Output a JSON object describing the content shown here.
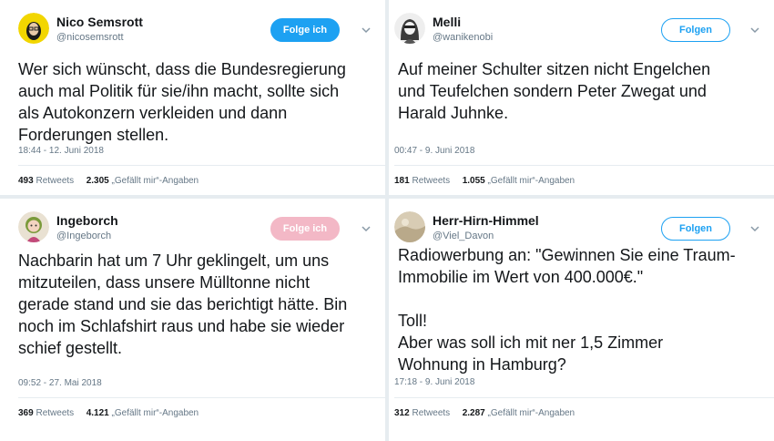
{
  "tweets": [
    {
      "name": "Nico Semsrott",
      "handle": "@nicosemsrott",
      "follow_label": "Folge ich",
      "text": "Wer sich wünscht, dass die Bundesregierung\nauch mal Politik für sie/ihn macht, sollte sich\nals Autokonzern verkleiden und dann\nForderungen stellen.",
      "time": "18:44 - 12. Juni 2018",
      "retweets": "493",
      "retweets_label": "Retweets",
      "likes": "2.305",
      "likes_label": "„Gefällt mir“-Angaben"
    },
    {
      "name": "Melli",
      "handle": "@wanikenobi",
      "follow_label": "Folgen",
      "text": "Auf meiner Schulter sitzen nicht Engelchen\nund Teufelchen sondern Peter Zwegat und\nHarald Juhnke.",
      "time": "00:47 - 9. Juni 2018",
      "retweets": "181",
      "retweets_label": "Retweets",
      "likes": "1.055",
      "likes_label": "„Gefällt mir“-Angaben"
    },
    {
      "name": "Ingeborch",
      "handle": "@Ingeborch",
      "follow_label": "Folge ich",
      "text": "Nachbarin hat um 7 Uhr geklingelt, um uns\nmitzuteilen, dass unsere Mülltonne nicht\ngerade stand und sie das berichtigt hätte. Bin\nnoch im Schlafshirt raus und habe sie wieder\nschief gestellt.",
      "time": "09:52 - 27. Mai 2018",
      "retweets": "369",
      "retweets_label": "Retweets",
      "likes": "4.121",
      "likes_label": "„Gefällt mir“-Angaben"
    },
    {
      "name": "Herr-Hirn-Himmel",
      "handle": "@Viel_Davon",
      "follow_label": "Folgen",
      "text": "Radiowerbung an: \"Gewinnen Sie eine Traum-\nImmobilie im Wert von 400.000€.\"\n\nToll!\nAber was soll ich mit ner 1,5 Zimmer\nWohnung in Hamburg?",
      "time": "17:18 - 9. Juni 2018",
      "retweets": "312",
      "retweets_label": "Retweets",
      "likes": "2.287",
      "likes_label": "„Gefällt mir“-Angaben"
    }
  ],
  "colors": {
    "accent": "#1da1f2",
    "muted": "#657786",
    "background": "#e6ecf0",
    "faded_follow": "#f3b8c6"
  },
  "icons": [
    "chevron-down-icon",
    "avatar"
  ]
}
